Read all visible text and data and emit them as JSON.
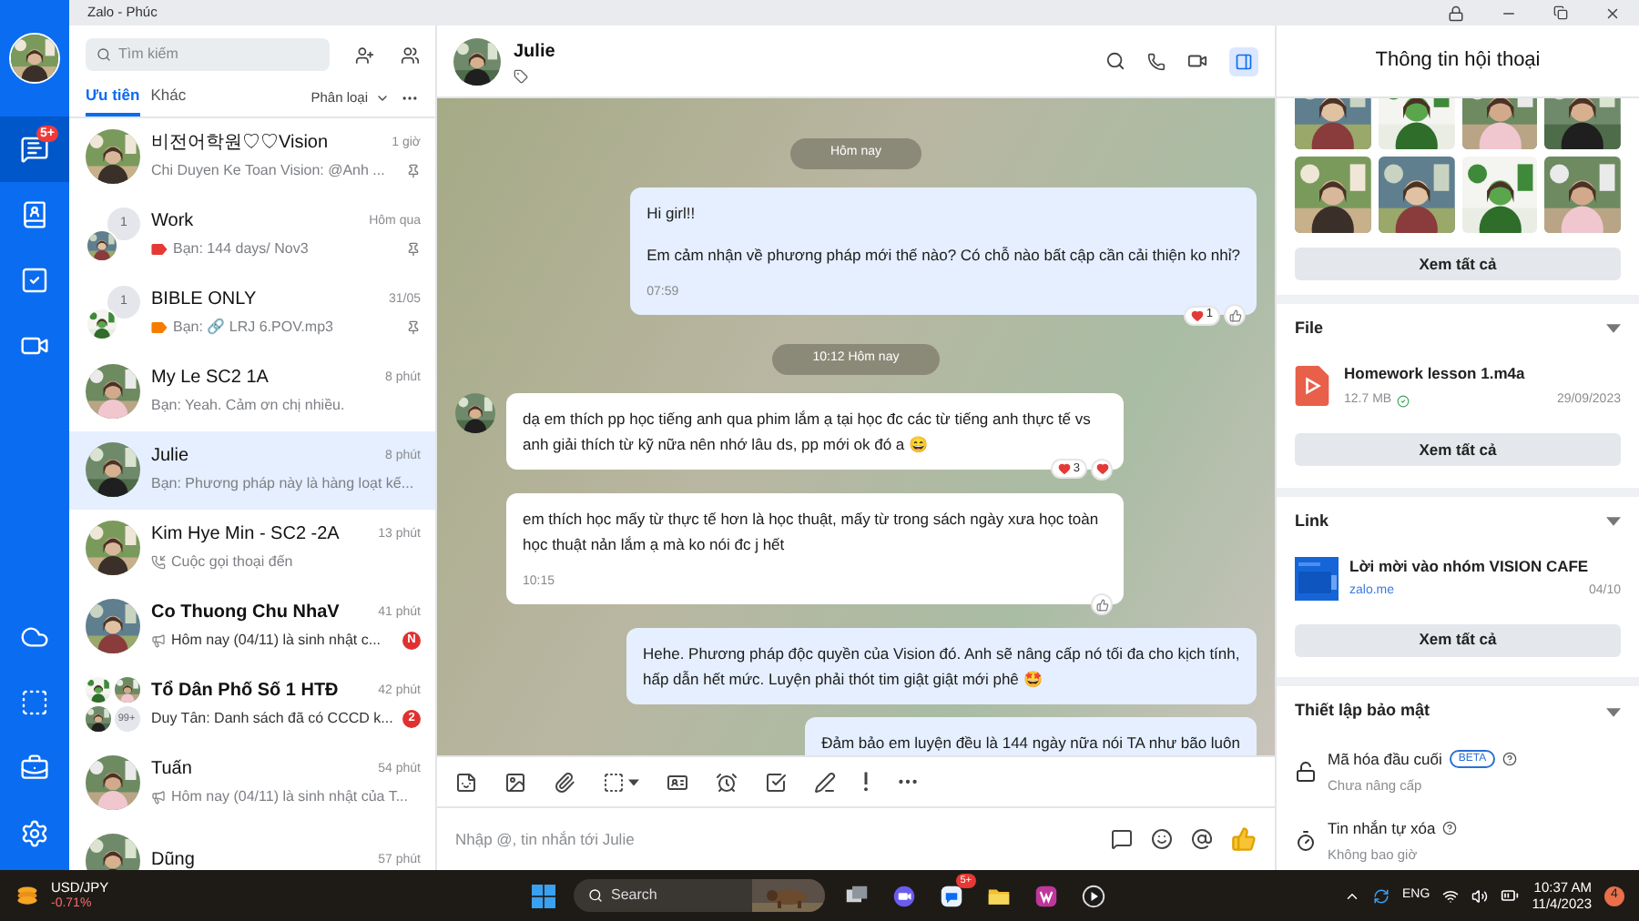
{
  "window": {
    "title": "Zalo - Phúc"
  },
  "nav": {
    "top": [
      {
        "kind": "chat",
        "selected": true,
        "badge": "5+"
      },
      {
        "kind": "contacts",
        "selected": false
      },
      {
        "kind": "todo",
        "selected": false
      },
      {
        "kind": "video",
        "selected": false
      }
    ],
    "bottom": [
      {
        "kind": "cloud",
        "selected": false
      },
      {
        "kind": "capture",
        "selected": false
      },
      {
        "kind": "tools",
        "selected": false
      },
      {
        "kind": "settings",
        "selected": false
      }
    ]
  },
  "search": {
    "placeholder": "Tìm kiếm"
  },
  "list_tabs": [
    {
      "label": "Ưu tiên",
      "selected": true
    },
    {
      "label": "Khác",
      "selected": false
    }
  ],
  "filter": {
    "label": "Phân loại"
  },
  "conversations": [
    {
      "name": "비전어학원♡♡Vision",
      "time": "1 giờ",
      "preview": "Chi Duyen Ke Toan Vision: @Anh ...",
      "pinned": true,
      "unread": false,
      "selected": false
    },
    {
      "name": "Work",
      "time": "Hôm qua",
      "preview": "Bạn: 144 days/ Nov3",
      "preview_icon": {
        "kind": "tag",
        "color": "#e53935"
      },
      "avatar": {
        "kind": "stack",
        "count": "1"
      },
      "pinned": true,
      "unread": false,
      "selected": false
    },
    {
      "name": "BIBLE ONLY",
      "time": "31/05",
      "preview": "Bạn: 🔗 LRJ 6.POV.mp3",
      "preview_icon": {
        "kind": "tag",
        "color": "#f57c00"
      },
      "avatar": {
        "kind": "stack",
        "count": "1"
      },
      "pinned": true,
      "unread": false,
      "selected": false
    },
    {
      "name": "My Le SC2 1A",
      "time": "8 phút",
      "preview": "Bạn: Yeah. Cảm ơn chị nhiều.",
      "pinned": false,
      "unread": false,
      "selected": false
    },
    {
      "name": "Julie",
      "time": "8 phút",
      "preview": "Bạn: Phương pháp này là hàng loạt kế...",
      "pinned": false,
      "unread": false,
      "selected": true
    },
    {
      "name": "Kim Hye Min - SC2 -2A",
      "time": "13 phút",
      "preview": "Cuộc gọi thoại đến",
      "preview_icon": {
        "kind": "call"
      },
      "pinned": false,
      "unread": false,
      "selected": false
    },
    {
      "name": "Co Thuong Chu NhaV",
      "time": "41 phút",
      "preview": "Hôm nay (04/11) là sinh nhật c...",
      "preview_icon": {
        "kind": "reminder"
      },
      "badge": "N",
      "pinned": false,
      "unread": true,
      "selected": false
    },
    {
      "name": "Tổ Dân Phố Số 1 HTĐ",
      "time": "42 phút",
      "preview": "Duy Tân: Danh sách đã có CCCD k...",
      "badge": "2",
      "avatar": {
        "kind": "group",
        "count": "99+"
      },
      "pinned": false,
      "unread": true,
      "selected": false
    },
    {
      "name": "Tuấn",
      "time": "54 phút",
      "preview": "Hôm nay (04/11) là sinh nhật của T...",
      "preview_icon": {
        "kind": "reminder"
      },
      "pinned": false,
      "unread": false,
      "selected": false
    },
    {
      "name": "Dũng",
      "time": "57 phút",
      "unread": false,
      "selected": false
    }
  ],
  "chat": {
    "name": "Julie",
    "messages": [
      {
        "kind": "date",
        "text": "Hôm nay"
      },
      {
        "kind": "sent",
        "paragraphs": [
          "Hi girl!!",
          "Em cảm nhận về phương pháp mới thế nào? Có chỗ nào bất cập cần cải thiện ko nhỉ?"
        ],
        "time": "07:59",
        "reaction_count": "1",
        "my_reaction": {
          "kind": "like"
        }
      },
      {
        "kind": "date",
        "text": "10:12 Hôm nay"
      },
      {
        "kind": "received",
        "show_avatar": true,
        "paragraphs": [
          "dạ em thích pp học tiếng anh qua phim lắm ạ tại học đc các từ tiếng anh thực tế vs anh giải thích từ kỹ nữa nên nhớ lâu ds, pp mới ok đó a 😄"
        ],
        "reaction_count": "3",
        "my_reaction": {
          "kind": "heart"
        }
      },
      {
        "kind": "received",
        "show_avatar": false,
        "paragraphs": [
          "em thích học mấy từ thực tế hơn là học thuật, mấy từ trong sách ngày xưa học toàn học thuật nản lắm ạ mà ko nói đc j hết"
        ],
        "time": "10:15",
        "my_reaction": {
          "kind": "like"
        }
      },
      {
        "kind": "sent",
        "paragraphs": [
          "Hehe. Phương pháp độc quyền của Vision đó. Anh sẽ nâng cấp nó tối đa cho kịch tính, hấp dẫn hết mức. Luyện phải thót tim giật giật mới phê 🤩"
        ]
      },
      {
        "kind": "sent",
        "paragraphs": [
          "Đảm bảo em luyện đều là 144 ngày nữa nói TA như bão luôn"
        ]
      }
    ],
    "input": {
      "placeholder": "Nhập @, tin nhắn tới Julie"
    }
  },
  "info": {
    "title": "Thông tin hội thoại",
    "photos_button": "Xem tất cả",
    "file_section": {
      "title": "File",
      "name": "Homework lesson 1.m4a",
      "size": "12.7 MB",
      "date": "29/09/2023",
      "button": "Xem tất cả"
    },
    "link_section": {
      "title": "Link",
      "name": "Lời mời vào nhóm VISION CAFE",
      "domain": "zalo.me",
      "date": "04/10",
      "button": "Xem tất cả"
    },
    "security": {
      "title": "Thiết lập bảo mật",
      "items": [
        {
          "kind": "encryption",
          "label": "Mã hóa đầu cuối",
          "badge": "BETA",
          "sub": "Chưa nâng cấp"
        },
        {
          "kind": "timer",
          "label": "Tin nhắn tự xóa",
          "sub": "Không bao giờ"
        }
      ]
    }
  },
  "taskbar": {
    "ticker": {
      "symbol": "USD/JPY",
      "change": "-0.71%"
    },
    "search": "Search",
    "apps": [
      {
        "kind": "task_view"
      },
      {
        "kind": "meet"
      },
      {
        "kind": "zalo",
        "badge": "5+"
      },
      {
        "kind": "explorer"
      },
      {
        "kind": "office"
      },
      {
        "kind": "media"
      }
    ],
    "language": "ENG",
    "time": "10:37 AM",
    "date": "11/4/2023",
    "notifications": "4"
  }
}
